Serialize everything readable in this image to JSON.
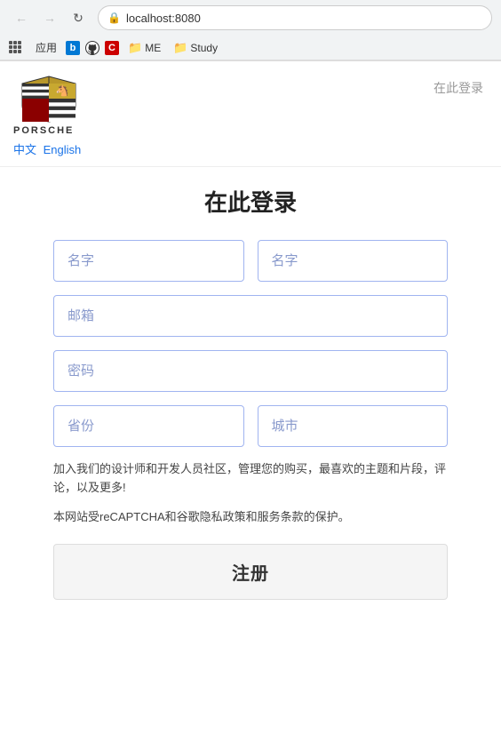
{
  "browser": {
    "url": "localhost:8080",
    "back_disabled": true,
    "forward_disabled": true,
    "bookmarks": [
      {
        "label": "应用",
        "type": "text"
      },
      {
        "label": "b",
        "type": "icon",
        "color": "#0078d4"
      },
      {
        "label": "github",
        "type": "icon",
        "color": "#333"
      },
      {
        "label": "C",
        "type": "icon",
        "color": "#c00"
      },
      {
        "label": "ME",
        "type": "folder"
      },
      {
        "label": "Study",
        "type": "folder"
      }
    ]
  },
  "header": {
    "login_link": "在此登录",
    "lang_zh": "中文",
    "lang_en": "English",
    "logo_brand": "PORSCHE"
  },
  "form": {
    "title": "在此登录",
    "first_name_placeholder": "名字",
    "last_name_placeholder": "名字",
    "email_placeholder": "邮箱",
    "password_placeholder": "密码",
    "province_placeholder": "省份",
    "city_placeholder": "城市",
    "info_text": "加入我们的设计师和开发人员社区，管理您的购买，最喜欢的主题和片段，评论，以及更多!",
    "recaptcha_text": "本网站受reCAPTCHA和谷歌隐私政策和服务条款的保护。",
    "submit_label": "注册"
  }
}
